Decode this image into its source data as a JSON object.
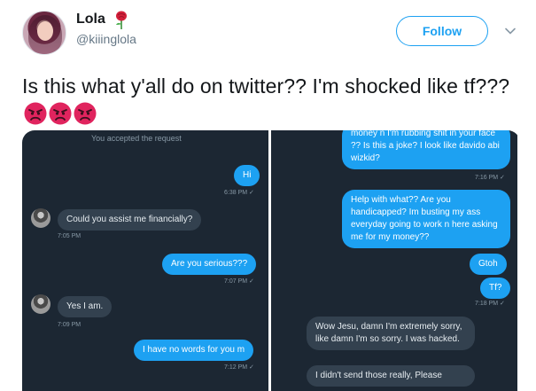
{
  "tweet": {
    "author_name": "Lola",
    "author_handle": "@kiiinglola",
    "follow_label": "Follow",
    "text": "Is this what y'all do on twitter?? I'm shocked like tf???",
    "emoji": [
      "angry-face",
      "angry-face",
      "angry-face"
    ]
  },
  "left_panel": {
    "system_line": "You accepted the request",
    "messages": [
      {
        "dir": "out",
        "text": "Hi",
        "time": "6:38 PM ✓"
      },
      {
        "dir": "in",
        "text": "Could you assist me financially?",
        "time": "7:05 PM"
      },
      {
        "dir": "out",
        "text": "Are you serious???",
        "time": "7:07 PM ✓"
      },
      {
        "dir": "in",
        "text": "Yes I am.",
        "time": "7:09 PM"
      },
      {
        "dir": "out",
        "text": "I have no words for you m",
        "time": "7:12 PM ✓"
      }
    ]
  },
  "right_panel": {
    "messages": [
      {
        "dir": "out",
        "text": "money n I'm rubbing shit in your face ?? Is this a joke? I look like davido abi wizkid?",
        "time": "7:16 PM ✓"
      },
      {
        "dir": "out",
        "text": "Help with what?? Are you handicapped? Im busting my ass everyday going to work n here asking me for my money??",
        "time": ""
      },
      {
        "dir": "out",
        "text": "Gtoh",
        "time": ""
      },
      {
        "dir": "out",
        "text": "Tf?",
        "time": "7:18 PM ✓"
      },
      {
        "dir": "in",
        "text": "Wow Jesu, damn I'm extremely sorry, like damn I'm so sorry. I was hacked.",
        "time": ""
      },
      {
        "dir": "in",
        "text": "I didn't send those really, Please",
        "time": ""
      }
    ]
  },
  "colors": {
    "twitter_blue": "#1da1f2",
    "dm_background": "#1c2733",
    "incoming_bubble": "#33414f",
    "angry_emoji": "#e0245e"
  }
}
